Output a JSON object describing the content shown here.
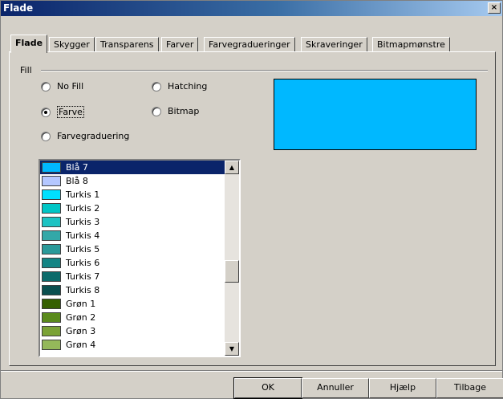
{
  "window": {
    "title": "Flade",
    "close_glyph": "×"
  },
  "tabs": [
    {
      "label": "Flade",
      "active": true
    },
    {
      "label": "Skygger"
    },
    {
      "label": "Transparens"
    },
    {
      "label": "Farver"
    },
    {
      "label": "Farvegradueringer"
    },
    {
      "label": "Skraveringer"
    },
    {
      "label": "Bitmapmønstre"
    }
  ],
  "fill": {
    "legend": "Fill",
    "options": {
      "no_fill": "No Fill",
      "farve": "Farve",
      "farvegraduering": "Farvegraduering",
      "hatching": "Hatching",
      "bitmap": "Bitmap"
    },
    "selected": "Farve",
    "preview_color": "#00b8ff"
  },
  "colors": [
    {
      "name": "Blå 7",
      "hex": "#00b8ff",
      "selected": true
    },
    {
      "name": "Blå 8",
      "hex": "#b4c7ff"
    },
    {
      "name": "Turkis 1",
      "hex": "#00e0ff"
    },
    {
      "name": "Turkis 2",
      "hex": "#00c6c6"
    },
    {
      "name": "Turkis 3",
      "hex": "#1cc3c3"
    },
    {
      "name": "Turkis 4",
      "hex": "#33a8a8"
    },
    {
      "name": "Turkis 5",
      "hex": "#2a9a9a"
    },
    {
      "name": "Turkis 6",
      "hex": "#138585"
    },
    {
      "name": "Turkis 7",
      "hex": "#0b6b6b"
    },
    {
      "name": "Turkis 8",
      "hex": "#0a4f4f"
    },
    {
      "name": "Grøn 1",
      "hex": "#356000"
    },
    {
      "name": "Grøn 2",
      "hex": "#5a8a1c"
    },
    {
      "name": "Grøn 3",
      "hex": "#7aa236"
    },
    {
      "name": "Grøn 4",
      "hex": "#94b85a"
    }
  ],
  "scrollbar": {
    "up_glyph": "▲",
    "down_glyph": "▼"
  },
  "buttons": {
    "ok": "OK",
    "cancel": "Annuller",
    "help": "Hjælp",
    "reset": "Tilbage"
  }
}
